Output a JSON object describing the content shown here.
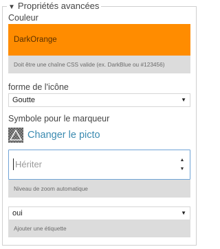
{
  "section": {
    "title": "Propriétés avancées",
    "expanded": true
  },
  "couleur": {
    "label": "Couleur",
    "value": "DarkOrange",
    "swatch": "#ff8c00",
    "help": "Doit être une chaîne CSS valide (ex. DarkBlue ou #123456)"
  },
  "icon_shape": {
    "label": "forme de l'icône",
    "selected": "Goutte"
  },
  "symbol": {
    "label": "Symbole pour le marqueur",
    "link": "Changer le picto"
  },
  "zoom": {
    "placeholder": "Hériter",
    "help": "Niveau de zoom automatique"
  },
  "label_toggle": {
    "selected": "oui",
    "help": "Ajouter une étiquette"
  },
  "colors": {
    "accent": "#3a8ab0",
    "focus_border": "#6fa3d6",
    "help_bg": "#dcdcdc"
  }
}
